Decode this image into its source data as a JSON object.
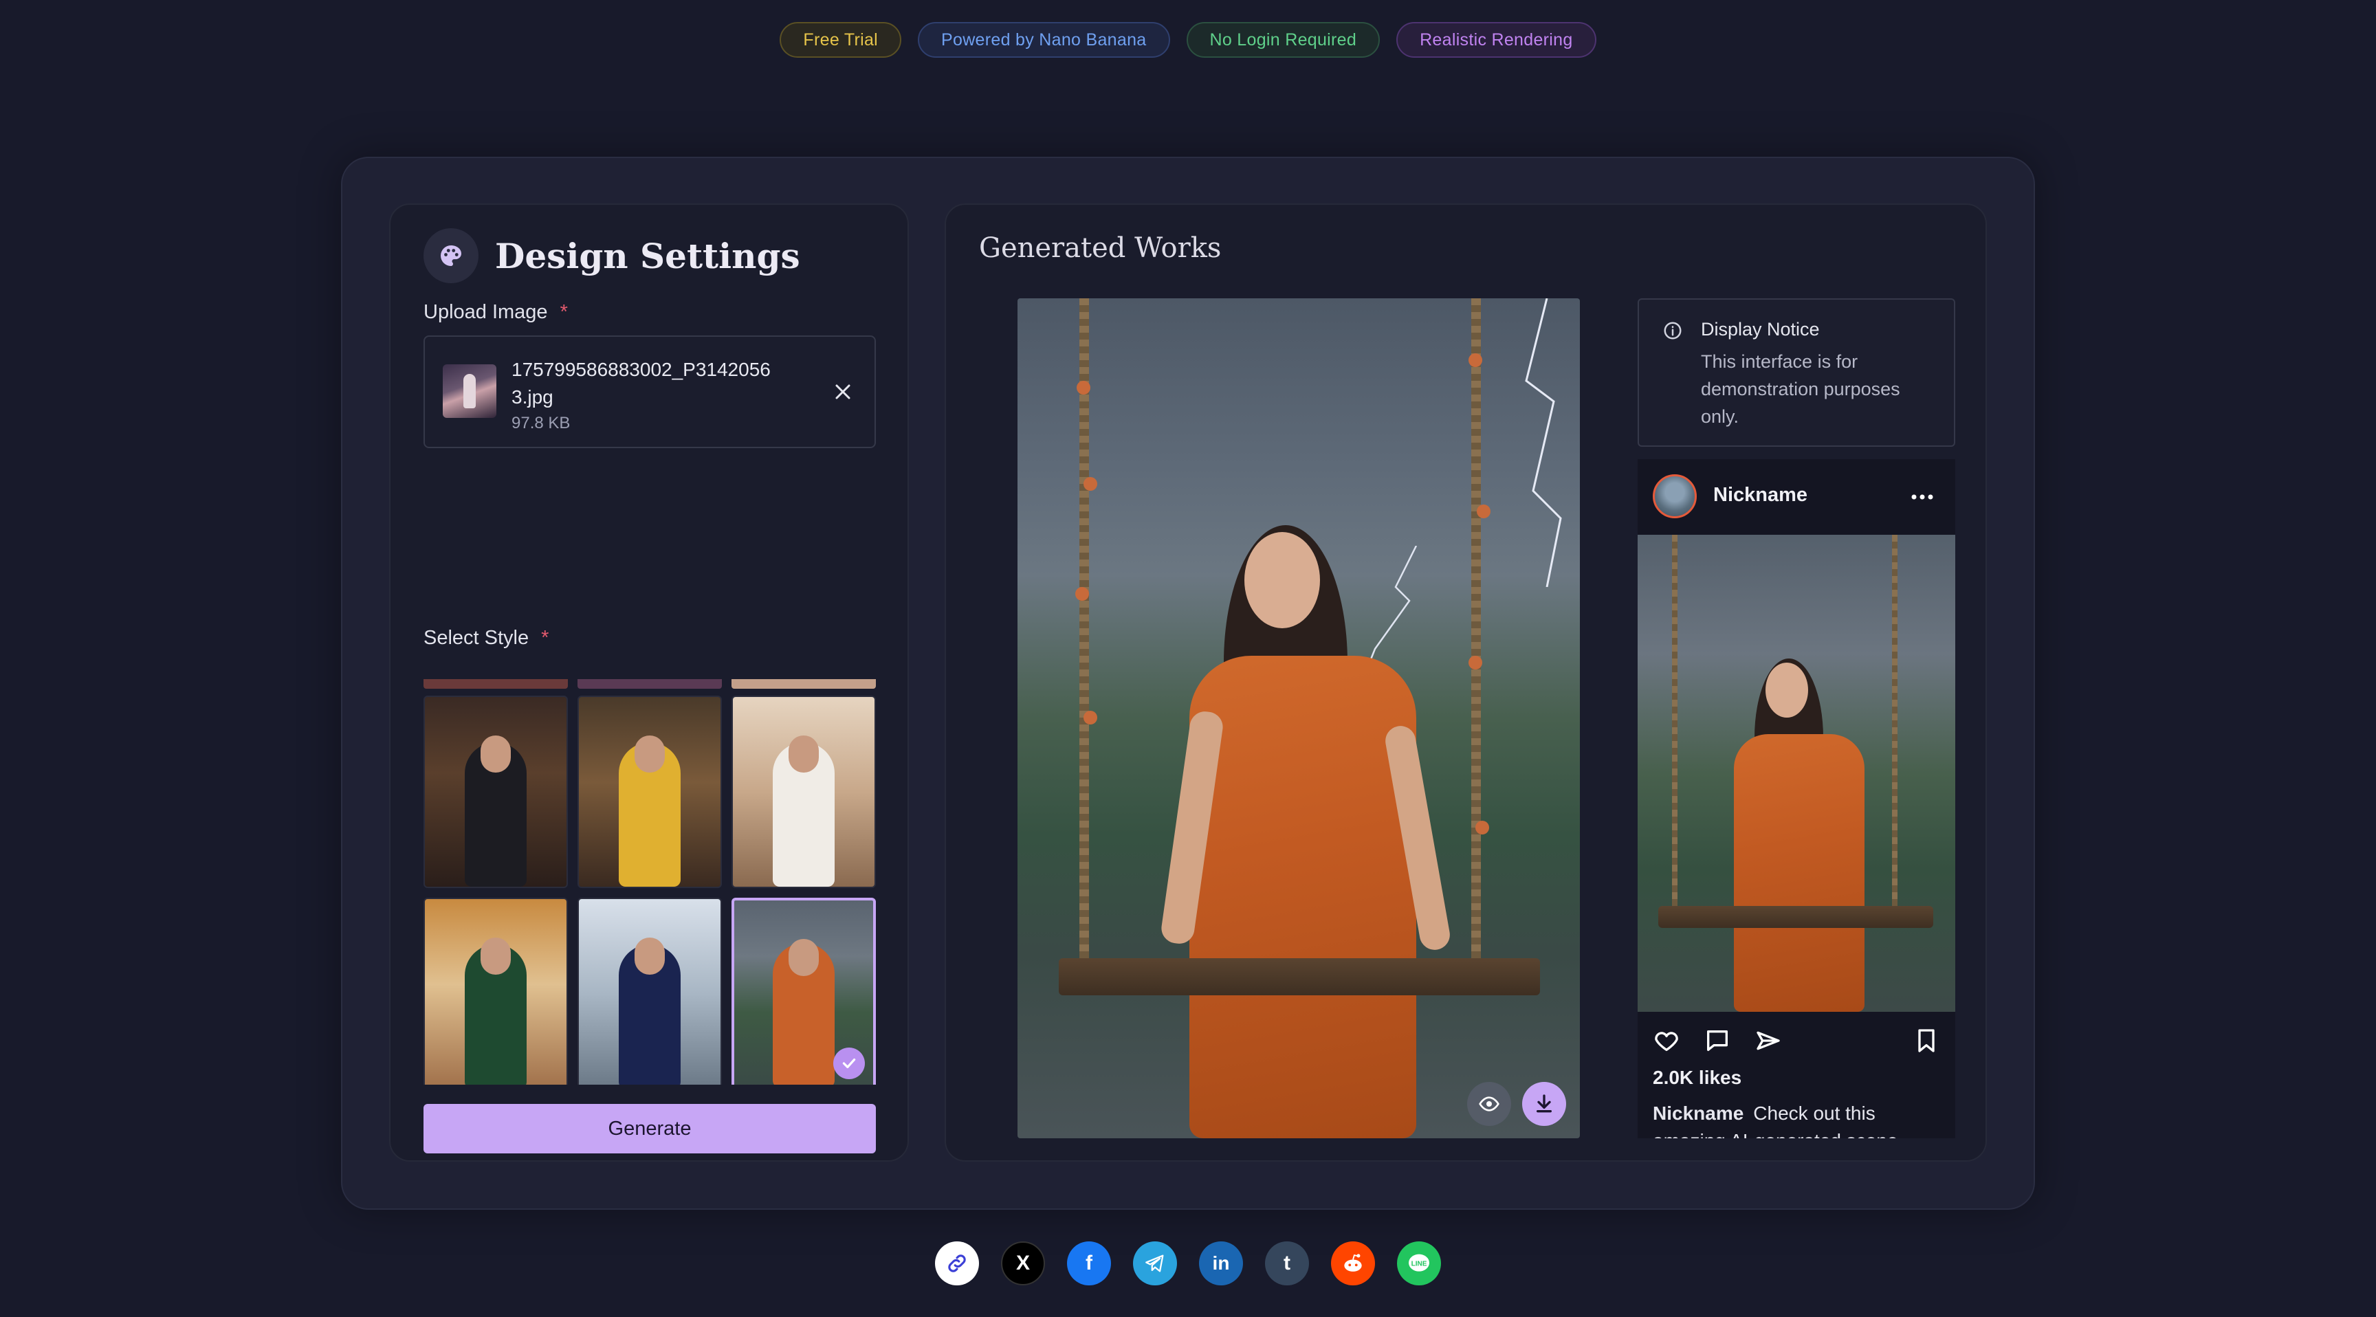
{
  "badges": [
    {
      "label": "Free Trial"
    },
    {
      "label": "Powered by Nano Banana"
    },
    {
      "label": "No Login Required"
    },
    {
      "label": "Realistic Rendering"
    }
  ],
  "design_settings": {
    "title": "Design Settings",
    "icon": "palette-icon",
    "upload": {
      "label": "Upload Image",
      "required_marker": "*",
      "file_name": "175799586883002_P3142056 3.jpg",
      "file_size": "97.8 KB"
    },
    "style": {
      "label": "Select Style",
      "required_marker": "*",
      "selected_index": 5
    },
    "generate_label": "Generate"
  },
  "generated_works": {
    "title": "Generated Works",
    "notice": {
      "title": "Display Notice",
      "body": "This interface is for demonstration purposes only."
    },
    "post": {
      "nickname": "Nickname",
      "likes": "2.0K likes",
      "caption_name": "Nickname",
      "caption_text": "Check out this amazing AI-generated scene"
    }
  },
  "share": [
    {
      "name": "copy-link",
      "glyph": "🔗",
      "color": "#ffffff"
    },
    {
      "name": "x",
      "glyph": "X",
      "color": "#000000"
    },
    {
      "name": "facebook",
      "glyph": "f",
      "color": "#1877f2"
    },
    {
      "name": "telegram",
      "glyph": "➤",
      "color": "#2aa3de"
    },
    {
      "name": "linkedin",
      "glyph": "in",
      "color": "#1a66b2"
    },
    {
      "name": "tumblr",
      "glyph": "t",
      "color": "#35465c"
    },
    {
      "name": "reddit",
      "glyph": "●",
      "color": "#ff4500"
    },
    {
      "name": "line",
      "glyph": "LINE",
      "color": "#22c55e"
    }
  ],
  "colors": {
    "accent": "#c7a6f5",
    "background": "#181a2b",
    "panel": "#1a1c2c"
  }
}
